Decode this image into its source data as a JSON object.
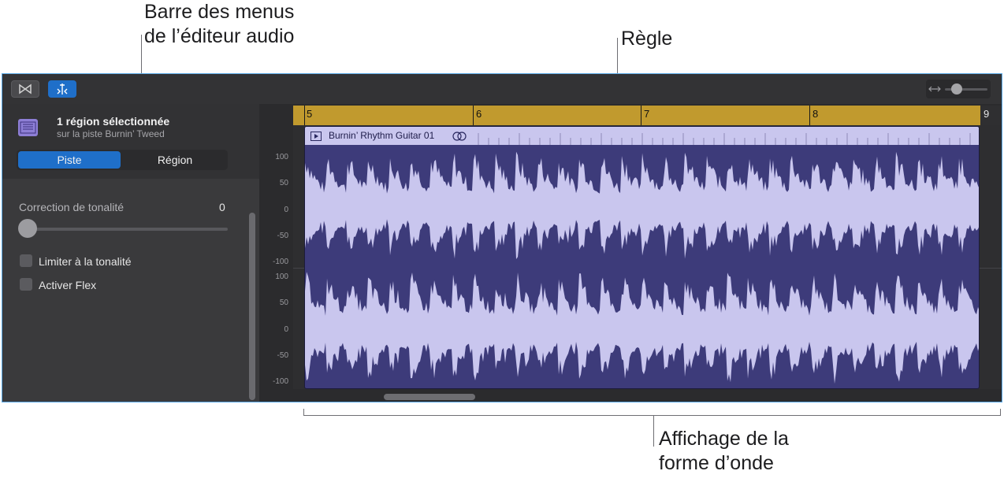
{
  "callouts": {
    "menu_bar": "Barre des menus\nde l’éditeur audio",
    "ruler": "Règle",
    "waveform": "Affichage de la\nforme d’onde"
  },
  "inspector": {
    "title": "1 région sélectionnée",
    "subtitle": "sur la piste Burnin’ Tweed",
    "tabs": [
      {
        "label": "Piste",
        "selected": true
      },
      {
        "label": "Région",
        "selected": false
      }
    ],
    "pitch_label": "Correction de tonalité",
    "pitch_value": "0",
    "limit_label": "Limiter à la tonalité",
    "flex_label": "Activer Flex"
  },
  "ruler": {
    "labels": [
      "5",
      "6",
      "7",
      "8",
      "9"
    ]
  },
  "region": {
    "name": "Burnin’ Rhythm Guitar 01"
  },
  "axis": {
    "top_labels": [
      "100",
      "50",
      "0",
      "-50",
      "-100"
    ],
    "bottom_labels": [
      "100",
      "50",
      "0",
      "-50",
      "-100"
    ]
  },
  "colors": {
    "accent": "#1f6fc9",
    "ruler": "#c19a2e",
    "region": "#3d3b7a",
    "waveform": "#c9c6ee"
  }
}
